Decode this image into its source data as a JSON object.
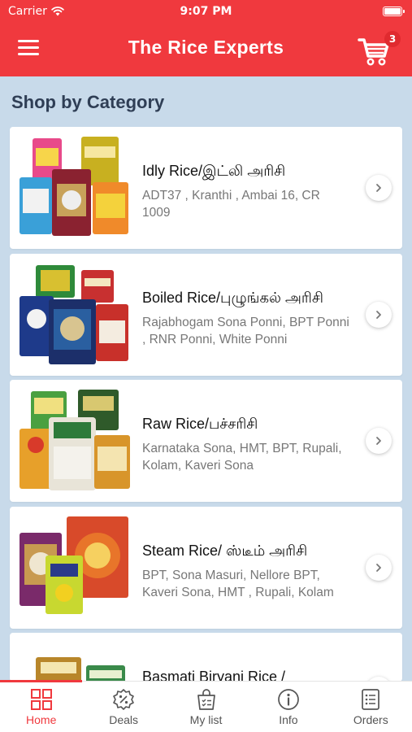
{
  "status_bar": {
    "carrier": "Carrier",
    "time": "9:07 PM"
  },
  "header": {
    "title": "The Rice Experts",
    "cart_count": "3"
  },
  "section_title": "Shop by Category",
  "categories": [
    {
      "name": "Idly Rice/இட்லி அரிசி",
      "description": "ADT37 , Kranthi , Ambai 16, CR 1009"
    },
    {
      "name": "Boiled Rice/புழுங்கல் அரிசி",
      "description": "Rajabhogam Sona Ponni, BPT Ponni , RNR Ponni, White Ponni"
    },
    {
      "name": "Raw Rice/பச்சரிசி",
      "description": "Karnataka Sona, HMT, BPT, Rupali, Kolam, Kaveri Sona"
    },
    {
      "name": "Steam Rice/ ஸ்டீம் அரிசி",
      "description": "BPT, Sona Masuri, Nellore BPT, Kaveri Sona, HMT , Rupali, Kolam"
    },
    {
      "name": "Basmati Biryani Rice /",
      "description": ""
    }
  ],
  "tabs": [
    {
      "label": "Home",
      "icon": "grid-icon"
    },
    {
      "label": "Deals",
      "icon": "discount-badge-icon"
    },
    {
      "label": "My list",
      "icon": "shopping-bag-list-icon"
    },
    {
      "label": "Info",
      "icon": "info-icon"
    },
    {
      "label": "Orders",
      "icon": "orders-list-icon"
    }
  ],
  "colors": {
    "brand_red": "#f0393e",
    "background": "#c8daea",
    "heading": "#2f3e55",
    "muted_text": "#777777"
  }
}
